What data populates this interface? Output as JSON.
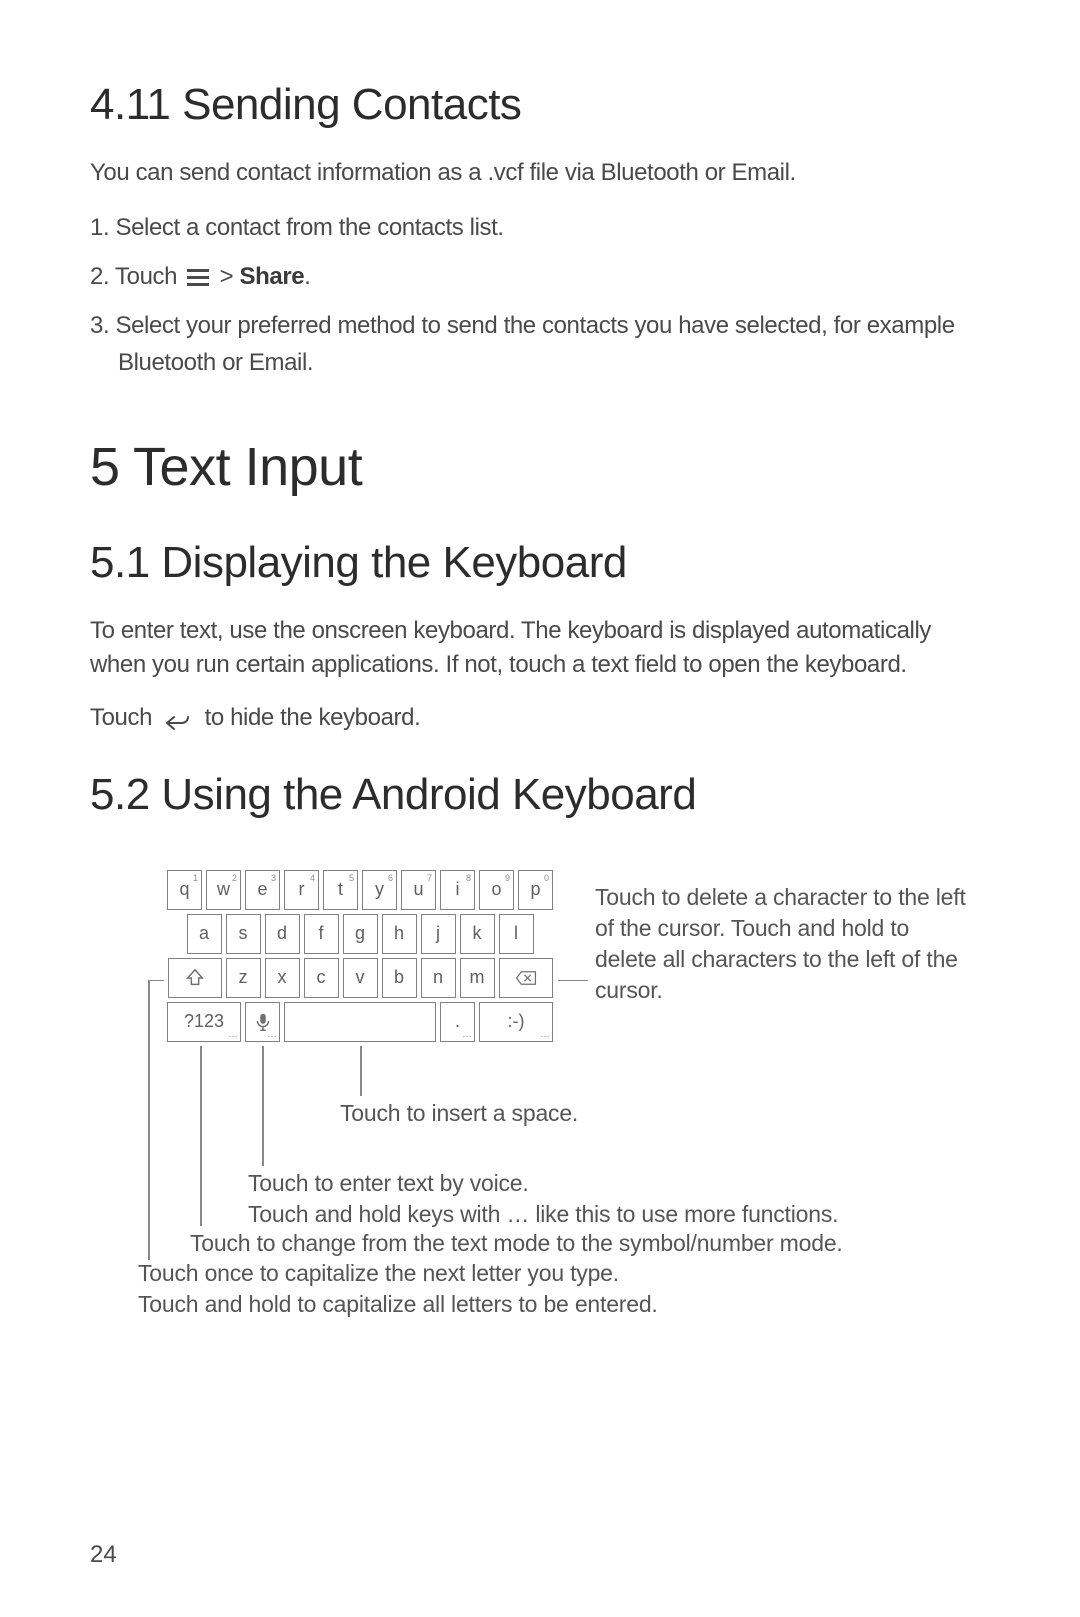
{
  "section_411": {
    "heading": "4.11  Sending Contacts",
    "intro": "You can send contact information as a .vcf file via Bluetooth or Email.",
    "step1": "1. Select a contact from the contacts list.",
    "step2_pre": "2. Touch ",
    "step2_mid": " > ",
    "step2_bold": "Share",
    "step2_post": ".",
    "step3": "3. Select your preferred method to send the contacts you have selected, for example Bluetooth or Email."
  },
  "chapter5": {
    "heading": "5  Text Input"
  },
  "section_51": {
    "heading": "5.1  Displaying the Keyboard",
    "para1": "To enter text, use the onscreen keyboard. The keyboard is displayed automatically when you run certain applications. If not, touch a text field to open the keyboard.",
    "para2_pre": "Touch ",
    "para2_post": " to hide the keyboard."
  },
  "section_52": {
    "heading": "5.2  Using the Android Keyboard"
  },
  "keyboard": {
    "row1": [
      {
        "l": "q",
        "s": "1"
      },
      {
        "l": "w",
        "s": "2"
      },
      {
        "l": "e",
        "s": "3"
      },
      {
        "l": "r",
        "s": "4"
      },
      {
        "l": "t",
        "s": "5"
      },
      {
        "l": "y",
        "s": "6"
      },
      {
        "l": "u",
        "s": "7"
      },
      {
        "l": "i",
        "s": "8"
      },
      {
        "l": "o",
        "s": "9"
      },
      {
        "l": "p",
        "s": "0"
      }
    ],
    "row2": [
      {
        "l": "a"
      },
      {
        "l": "s"
      },
      {
        "l": "d"
      },
      {
        "l": "f"
      },
      {
        "l": "g"
      },
      {
        "l": "h"
      },
      {
        "l": "j"
      },
      {
        "l": "k"
      },
      {
        "l": "l"
      }
    ],
    "row3": [
      {
        "l": "z"
      },
      {
        "l": "x"
      },
      {
        "l": "c"
      },
      {
        "l": "v"
      },
      {
        "l": "b"
      },
      {
        "l": "n"
      },
      {
        "l": "m"
      }
    ],
    "mode_key": "?123",
    "period_key": ".",
    "smiley_key": ":-)"
  },
  "annotations": {
    "delete": "Touch to delete a character to the left of the cursor. Touch and hold to delete all characters to the left of the cursor.",
    "space": "Touch to insert a space.",
    "voice": "Touch to enter text by voice.\nTouch and hold keys with … like this to use more functions.",
    "mode": "Touch to change from the text mode to the symbol/number mode.",
    "shift": "Touch once to capitalize the next letter you type.\nTouch and hold to capitalize all letters to be entered."
  },
  "page_number": "24"
}
